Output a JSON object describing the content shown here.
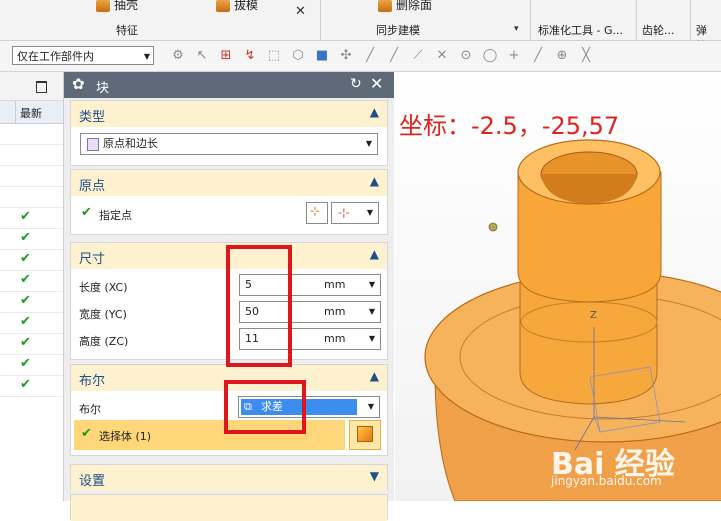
{
  "ribbon": {
    "top_items": [
      "抽壳",
      "拔模",
      "删除面"
    ],
    "groups": [
      "特征",
      "同步建模",
      "标准化工具 - G...",
      "齿轮...",
      "弹簧..."
    ]
  },
  "toolbar": {
    "scope_select": "仅在工作部件内"
  },
  "navigator": {
    "column_header": "最新",
    "checked_rows": 9
  },
  "dialog": {
    "title": "块",
    "sections": {
      "type": {
        "label": "类型",
        "value": "原点和边长"
      },
      "origin": {
        "label": "原点",
        "specify_point": "指定点"
      },
      "dimensions": {
        "label": "尺寸",
        "rows": [
          {
            "label": "长度 (XC)",
            "value": "5",
            "unit": "mm"
          },
          {
            "label": "宽度 (YC)",
            "value": "50",
            "unit": "mm"
          },
          {
            "label": "高度 (ZC)",
            "value": "11",
            "unit": "mm"
          }
        ]
      },
      "boolean": {
        "label": "布尔",
        "field_label": "布尔",
        "value": "求差",
        "select_body": "选择体 (1)"
      },
      "settings": {
        "label": "设置"
      }
    }
  },
  "viewport": {
    "coordinate_text": "坐标：-2.5，-25,57",
    "axis_label": "Z",
    "watermark_logo": "Bai 经验",
    "watermark_url": "jingyan.baidu.com"
  },
  "colors": {
    "annotation_red": "#e0161e",
    "section_header_bg": "#fdf1cf",
    "dialog_title_bg": "#5e6a78",
    "part_orange": "#f7a637",
    "selection_blue": "#3d8cf0"
  }
}
